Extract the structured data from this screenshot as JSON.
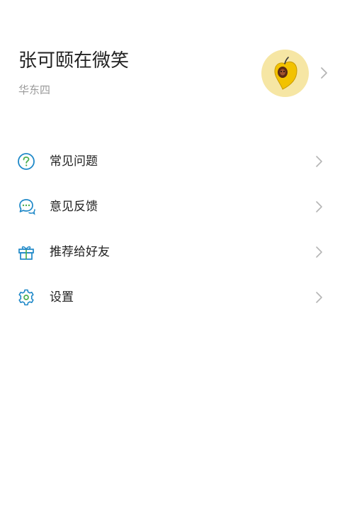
{
  "profile": {
    "name": "张可颐在微笑",
    "region": "华东四"
  },
  "menu": {
    "items": [
      {
        "label": "常见问题",
        "icon": "help-circle-icon"
      },
      {
        "label": "意见反馈",
        "icon": "chat-bubbles-icon"
      },
      {
        "label": "推荐给好友",
        "icon": "gift-icon"
      },
      {
        "label": "设置",
        "icon": "gear-icon"
      }
    ]
  },
  "colors": {
    "accent": "#1e88c8",
    "help_accent": "#4caf50",
    "text": "#222222",
    "muted": "#9a9a9a",
    "chevron": "#b5b5b5",
    "avatar_bg": "#f6e6a4",
    "avatar_fruit": "#f2c200"
  }
}
